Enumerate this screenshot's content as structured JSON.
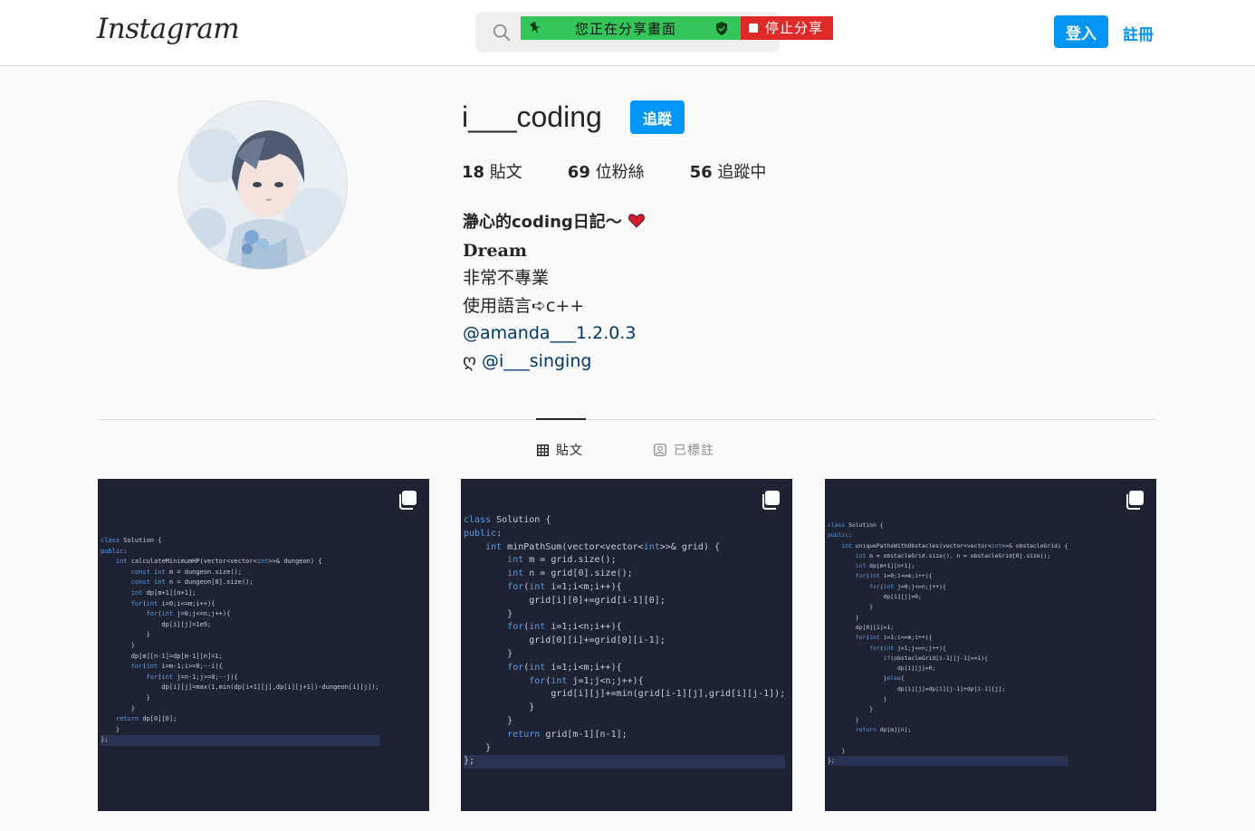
{
  "header": {
    "logo": "Instagram",
    "share_text": "您正在分享畫面",
    "stop_share": "停止分享",
    "login_label": "登入",
    "signup_label": "註冊"
  },
  "profile": {
    "username": "i___coding",
    "follow_label": "追蹤",
    "stats": {
      "posts_count": "18",
      "posts_label": "貼文",
      "followers_count": "69",
      "followers_label": "位粉絲",
      "following_count": "56",
      "following_label": "追蹤中"
    },
    "bio": {
      "name": "瀞心的coding日記～",
      "line1": "𝐃𝐫𝐞𝐚𝐦",
      "line2": "非常不專業",
      "line3": "使用語言➪c++",
      "link1": "@amanda___1.2.0.3",
      "line5_prefix": "ღ ",
      "link2": "@i___singing"
    }
  },
  "tabs": {
    "posts": "貼文",
    "tagged": "已標註"
  },
  "posts": [
    {
      "code": [
        "class Solution {",
        "public:",
        "    int calculateMinimumHP(vector<vector<int>>& dungeon) {",
        "        const int m = dungeon.size();",
        "        const int n = dungeon[0].size();",
        "        int dp[m+1][n+1];",
        "        for(int i=0;i<=m;i++){",
        "            for(int j=0;j<=n;j++){",
        "                dp[i][j]=1e9;",
        "            }",
        "        }",
        "        dp[m][n-1]=dp[m-1][n]=1;",
        "        for(int i=m-1;i>=0;--i){",
        "            for(int j=n-1;j>=0;--j){",
        "                dp[i][j]=max(1,min(dp[i+1][j],dp[i][j+1])-dungeon[i][j]);",
        "            }",
        "        }",
        "    return dp[0][0];",
        "    }",
        "};"
      ]
    },
    {
      "code": [
        "class Solution {",
        "public:",
        "    int minPathSum(vector<vector<int>>& grid) {",
        "        int m = grid.size();",
        "        int n = grid[0].size();",
        "        for(int i=1;i<m;i++){",
        "            grid[i][0]+=grid[i-1][0];",
        "        }",
        "        for(int i=1;i<n;i++){",
        "            grid[0][i]+=grid[0][i-1];",
        "        }",
        "        for(int i=1;i<m;i++){",
        "            for(int j=1;j<n;j++){",
        "                grid[i][j]+=min(grid[i-1][j],grid[i][j-1]);",
        "            }",
        "        }",
        "        return grid[m-1][n-1];",
        "    }",
        "};"
      ]
    },
    {
      "code": [
        "class Solution {",
        "public:",
        "    int uniquePathsWithObstacles(vector<vector<int>>& obstacleGrid) {",
        "        int m = obstacleGrid.size(), n = obstacleGrid[0].size();",
        "        int dp[m+1][n+1];",
        "        for(int i=0;i<=m;i++){",
        "            for(int j=0;j<=n;j++){",
        "                dp[i][j]=0;",
        "            }",
        "        }",
        "        dp[0][1]=1;",
        "        for(int i=1;i<=m;i++){",
        "            for(int j=1;j<=n;j++){",
        "                if(obstacleGrid[i-1][j-1]==1){",
        "                    dp[i][j]=0;",
        "                }else{",
        "                    dp[i][j]=dp[i][j-1]+dp[i-1][j];",
        "                }",
        "            }",
        "        }",
        "        return dp[m][n];",
        "",
        "    }",
        "};"
      ]
    }
  ]
}
